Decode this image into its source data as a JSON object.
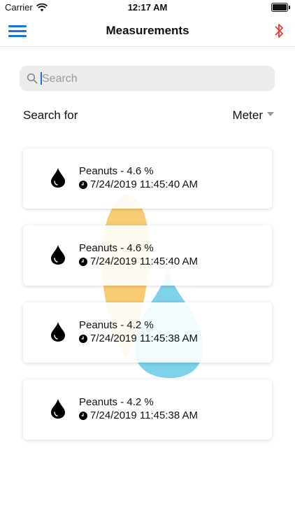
{
  "status": {
    "carrier": "Carrier",
    "time": "12:17 AM"
  },
  "nav": {
    "title": "Measurements"
  },
  "search": {
    "placeholder": "Search"
  },
  "filter": {
    "label": "Search for",
    "selected": "Meter"
  },
  "measurements": [
    {
      "title": "Peanuts - 4.6 %",
      "timestamp": "7/24/2019 11:45:40 AM"
    },
    {
      "title": "Peanuts - 4.6 %",
      "timestamp": "7/24/2019 11:45:40 AM"
    },
    {
      "title": "Peanuts - 4.2 %",
      "timestamp": "7/24/2019 11:45:38 AM"
    },
    {
      "title": "Peanuts - 4.2 %",
      "timestamp": "7/24/2019 11:45:38 AM"
    }
  ],
  "colors": {
    "accent": "#1976d2",
    "bluetooth": "#e53935",
    "watermark_orange": "#f5b93b",
    "watermark_blue": "#4cc0e0"
  },
  "icons": {
    "menu": "menu-icon",
    "bluetooth": "bluetooth-icon",
    "search": "search-icon",
    "drop": "drop-icon",
    "clock": "clock-icon"
  }
}
